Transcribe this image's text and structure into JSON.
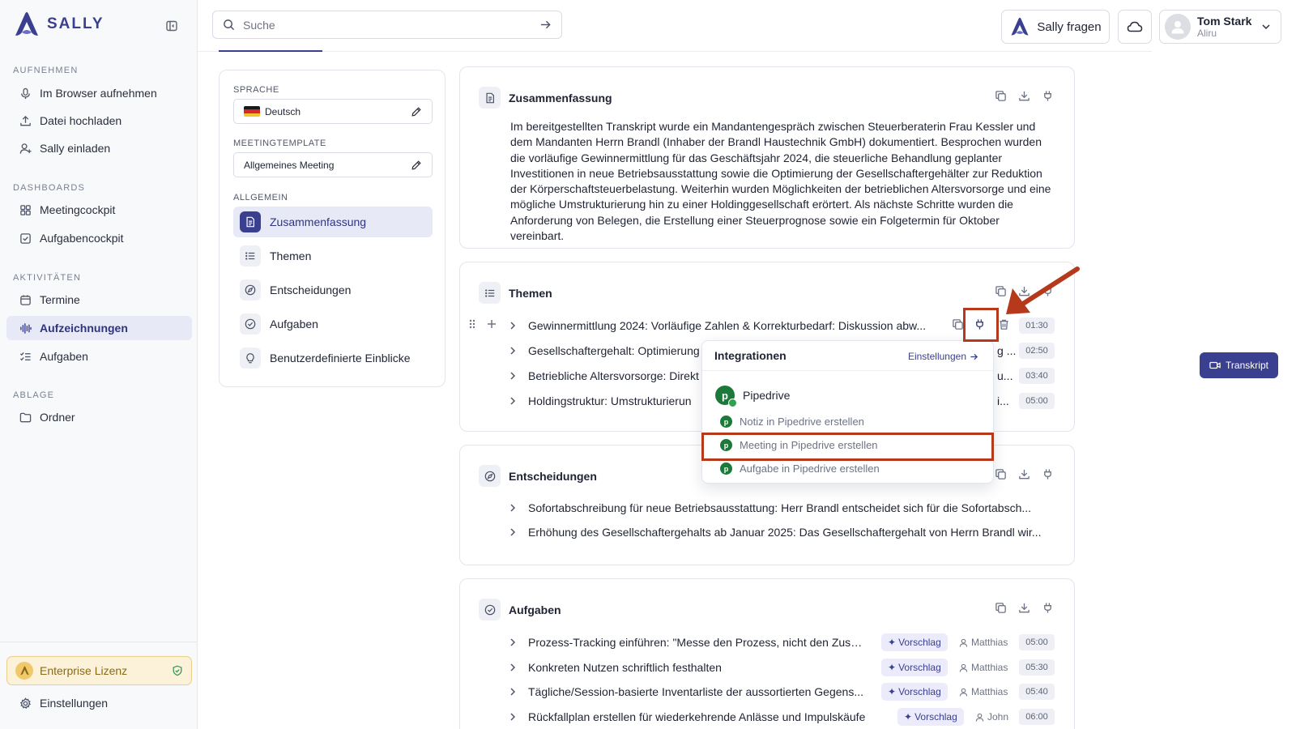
{
  "app": {
    "brand": "SALLY",
    "brand_color": "#3a3f8f"
  },
  "sidebar": {
    "sections": [
      {
        "title": "AUFNEHMEN",
        "items": [
          {
            "label": "Im Browser aufnehmen",
            "icon": "mic-icon"
          },
          {
            "label": "Datei hochladen",
            "icon": "upload-icon"
          },
          {
            "label": "Sally einladen",
            "icon": "user-plus-icon"
          }
        ]
      },
      {
        "title": "DASHBOARDS",
        "items": [
          {
            "label": "Meetingcockpit",
            "icon": "grid-icon"
          },
          {
            "label": "Aufgabencockpit",
            "icon": "check-square-icon"
          }
        ]
      },
      {
        "title": "AKTIVITÄTEN",
        "items": [
          {
            "label": "Termine",
            "icon": "calendar-icon"
          },
          {
            "label": "Aufzeichnungen",
            "icon": "waveform-icon",
            "active": true
          },
          {
            "label": "Aufgaben",
            "icon": "checklist-icon"
          }
        ]
      },
      {
        "title": "ABLAGE",
        "items": [
          {
            "label": "Ordner",
            "icon": "folder-icon"
          }
        ]
      }
    ],
    "license": "Enterprise Lizenz",
    "settings": "Einstellungen"
  },
  "topbar": {
    "search_placeholder": "Suche",
    "ask_label": "Sally fragen",
    "user": {
      "name": "Tom Stark",
      "org": "Aliru"
    }
  },
  "panel": {
    "language_label": "SPRACHE",
    "language_value": "Deutsch",
    "template_label": "MEETINGTEMPLATE",
    "template_value": "Allgemeines Meeting",
    "general_label": "ALLGEMEIN",
    "items": [
      "Zusammenfassung",
      "Themen",
      "Entscheidungen",
      "Aufgaben",
      "Benutzerdefinierte Einblicke"
    ]
  },
  "summary": {
    "title": "Zusammenfassung",
    "text": "Im bereitgestellten Transkript wurde ein Mandantengespräch zwischen Steuerberaterin Frau Kessler und dem Mandanten Herrn Brandl (Inhaber der Brandl Haustechnik GmbH) dokumentiert. Besprochen wurden die vorläufige Gewinnermittlung für das Geschäftsjahr 2024, die steuerliche Behandlung geplanter Investitionen in neue Betriebsausstattung sowie die Optimierung der Gesellschaftergehälter zur Reduktion der Körperschaftsteuerbelastung. Weiterhin wurden Möglichkeiten der betrieblichen Altersvorsorge und eine mögliche Umstrukturierung hin zu einer Holdinggesellschaft erörtert. Als nächste Schritte wurden die Anforderung von Belegen, die Erstellung einer Steuerprognose sowie ein Folgetermin für Oktober vereinbart."
  },
  "topics": {
    "title": "Themen",
    "rows": [
      {
        "text": "Gewinnermittlung 2024: Vorläufige Zahlen & Korrekturbedarf: Diskussion abw...",
        "time": "01:30"
      },
      {
        "text": "Gesellschaftergehalt: Optimierung",
        "tail": "g ...",
        "time": "02:50"
      },
      {
        "text": "Betriebliche Altersvorsorge: Direkt",
        "tail": "u...",
        "time": "03:40"
      },
      {
        "text": "Holdingstruktur: Umstrukturierun",
        "tail": "i...",
        "time": "05:00"
      }
    ]
  },
  "decisions": {
    "title": "Entscheidungen",
    "rows": [
      "Sofortabschreibung für neue Betriebsausstattung: Herr Brandl entscheidet sich für die Sofortabsch...",
      "Erhöhung des Gesellschaftergehalts ab Januar 2025: Das Gesellschaftergehalt von Herrn Brandl wir..."
    ]
  },
  "tasks": {
    "title": "Aufgaben",
    "rows": [
      {
        "text": "Prozess-Tracking einführen: \"Messe den Prozess, nicht den Zusta...",
        "tag": "Vorschlag",
        "assignee": "Matthias",
        "time": "05:00"
      },
      {
        "text": "Konkreten Nutzen schriftlich festhalten",
        "tag": "Vorschlag",
        "assignee": "Matthias",
        "time": "05:30"
      },
      {
        "text": "Tägliche/Session-basierte Inventarliste der aussortierten Gegens...",
        "tag": "Vorschlag",
        "assignee": "Matthias",
        "time": "05:40"
      },
      {
        "text": "Rückfallplan erstellen für wiederkehrende Anlässe und Impulskäufe",
        "tag": "Vorschlag",
        "assignee": "John",
        "time": "06:00"
      }
    ]
  },
  "popover": {
    "title": "Integrationen",
    "settings": "Einstellungen",
    "provider": "Pipedrive",
    "actions": [
      "Notiz in Pipedrive erstellen",
      "Meeting in Pipedrive erstellen",
      "Aufgabe in Pipedrive erstellen"
    ]
  },
  "transcript_button": "Transkript",
  "colors": {
    "highlight": "#b5391a",
    "pipedrive": "#1b7a3a",
    "accent": "#3a3f8f"
  }
}
